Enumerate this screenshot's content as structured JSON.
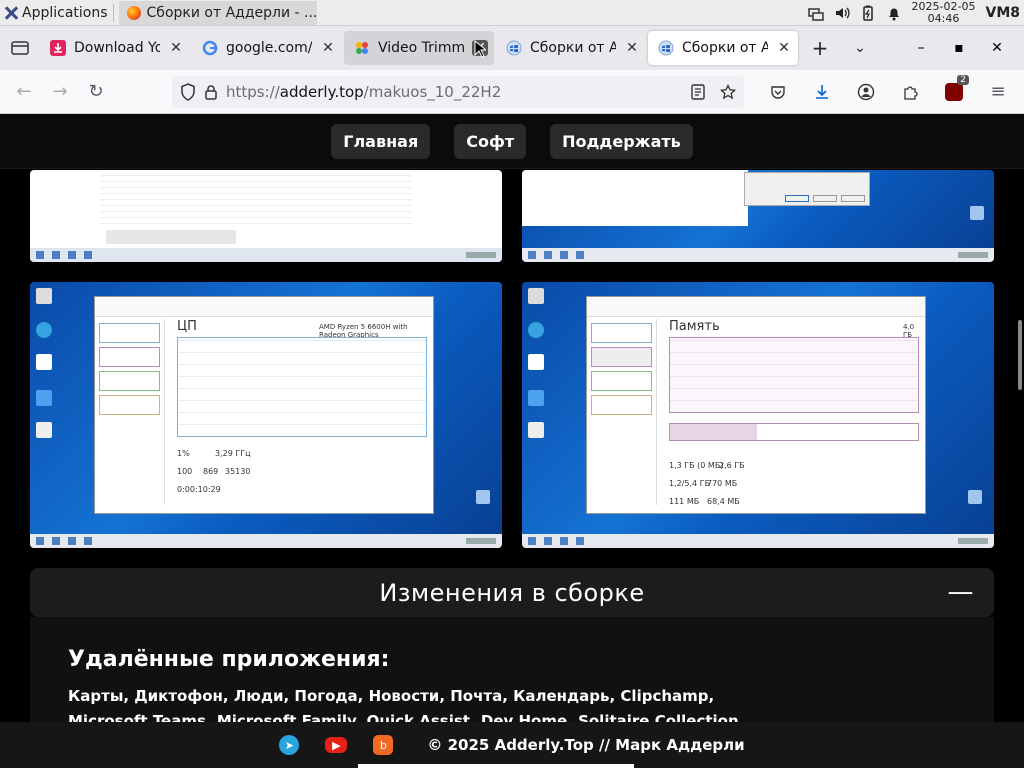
{
  "os": {
    "applications_label": "Applications",
    "task_title": "Сборки от Аддерли - ...",
    "clock_date": "2025-02-05",
    "clock_time": "04:46",
    "user": "VM8"
  },
  "tabs": [
    {
      "title": "Download You",
      "favicon": "download-icon",
      "color": "#e0245e"
    },
    {
      "title": "google.com/sc",
      "favicon": "google-icon",
      "color": "#4285f4"
    },
    {
      "title": "Video Trimme",
      "favicon": "video-trimmer-icon",
      "color": "#3b82f6"
    },
    {
      "title": "Сборки от Ад",
      "favicon": "windows-logo-icon",
      "color": "#8fb3e0"
    },
    {
      "title": "Сборки от Ад",
      "favicon": "windows-logo-icon",
      "color": "#8fb3e0"
    }
  ],
  "url": {
    "scheme": "https://",
    "host": "adderly.top",
    "path": "/makuos_10_22H2"
  },
  "extensions_badge": "2",
  "site_nav": [
    "Главная",
    "Софт",
    "Поддержать"
  ],
  "screenshots": {
    "cpu": {
      "title": "ЦП",
      "cpu_model": "AMD Ryzen 5 6600H with Radeon Graphics",
      "usage": "1%",
      "speed": "3,29 ГГц",
      "processes": "100",
      "threads": "869",
      "handles": "35130",
      "uptime": "0:00:10:29"
    },
    "memory": {
      "title": "Память",
      "total": "4,0 ГБ",
      "in_use": "1,3 ГБ (0 МБ)",
      "available": "2,6 ГБ",
      "committed": "1,2/5,4 ГБ",
      "cached": "770 МБ",
      "paged": "111 МБ",
      "nonpaged": "68,4 МБ"
    }
  },
  "accordion": {
    "title": "Изменения в сборке",
    "toggle": "—",
    "heading": "Удалённые приложения:",
    "line1": "Карты, Диктофон, Люди, Погода, Новости, Почта, Календарь, Clipchamp,",
    "line2": "Microsoft Teams, Microsoft Family, Quick Assist, Dev Home, Solitaire Collection,"
  },
  "footer": {
    "copyright": "© 2025 Adderly.Top // Марк Аддерли"
  }
}
